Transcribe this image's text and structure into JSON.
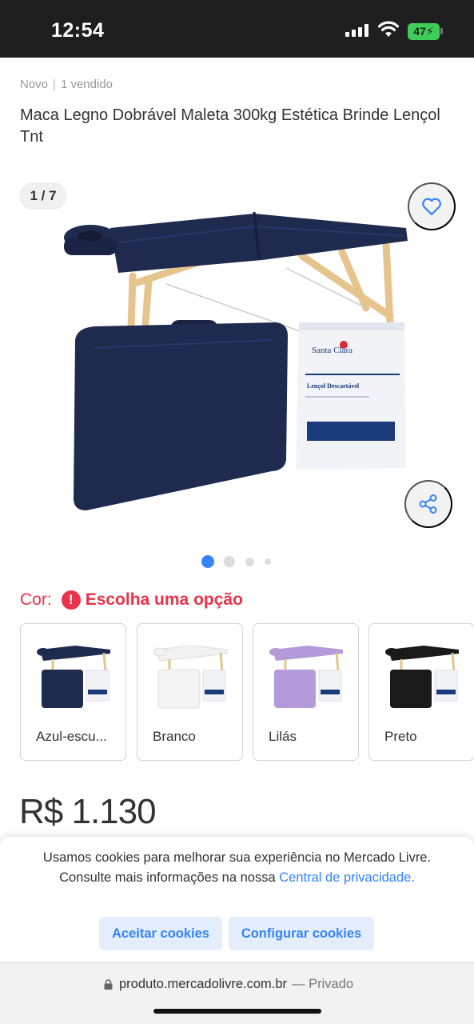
{
  "status_bar": {
    "time": "12:54",
    "battery": "47"
  },
  "product": {
    "condition": "Novo",
    "sold": "1 vendido",
    "title": "Maca Legno Dobrável Maleta 300kg Estética Brinde Lençol Tnt",
    "image_counter": "1 / 7",
    "bag_brand": "Santa Clara",
    "bag_label": "Lençol Descartável"
  },
  "gallery": {
    "total_dots": 4,
    "active_dot": 1
  },
  "color_picker": {
    "label": "Cor:",
    "warning": "Escolha uma opção",
    "options": [
      {
        "label": "Azul-escu...",
        "color": "#1f2a4f"
      },
      {
        "label": "Branco",
        "color": "#f2f2f2"
      },
      {
        "label": "Lilás",
        "color": "#b49ad8"
      },
      {
        "label": "Preto",
        "color": "#1a1a1a"
      }
    ]
  },
  "price": {
    "text": "R$ 1.130"
  },
  "cookie_banner": {
    "text": "Usamos cookies para melhorar sua experiência no Mercado Livre. Consulte mais informações na nossa",
    "link": "Central de privacidade.",
    "accept_label": "Aceitar cookies",
    "configure_label": "Configurar cookies"
  },
  "browser": {
    "url": "produto.mercadolivre.com.br",
    "mode": "— Privado"
  },
  "colors": {
    "accent": "#3483fa",
    "error": "#e8334a",
    "table": "#1f2a4f",
    "wood": "#e6c58d"
  }
}
